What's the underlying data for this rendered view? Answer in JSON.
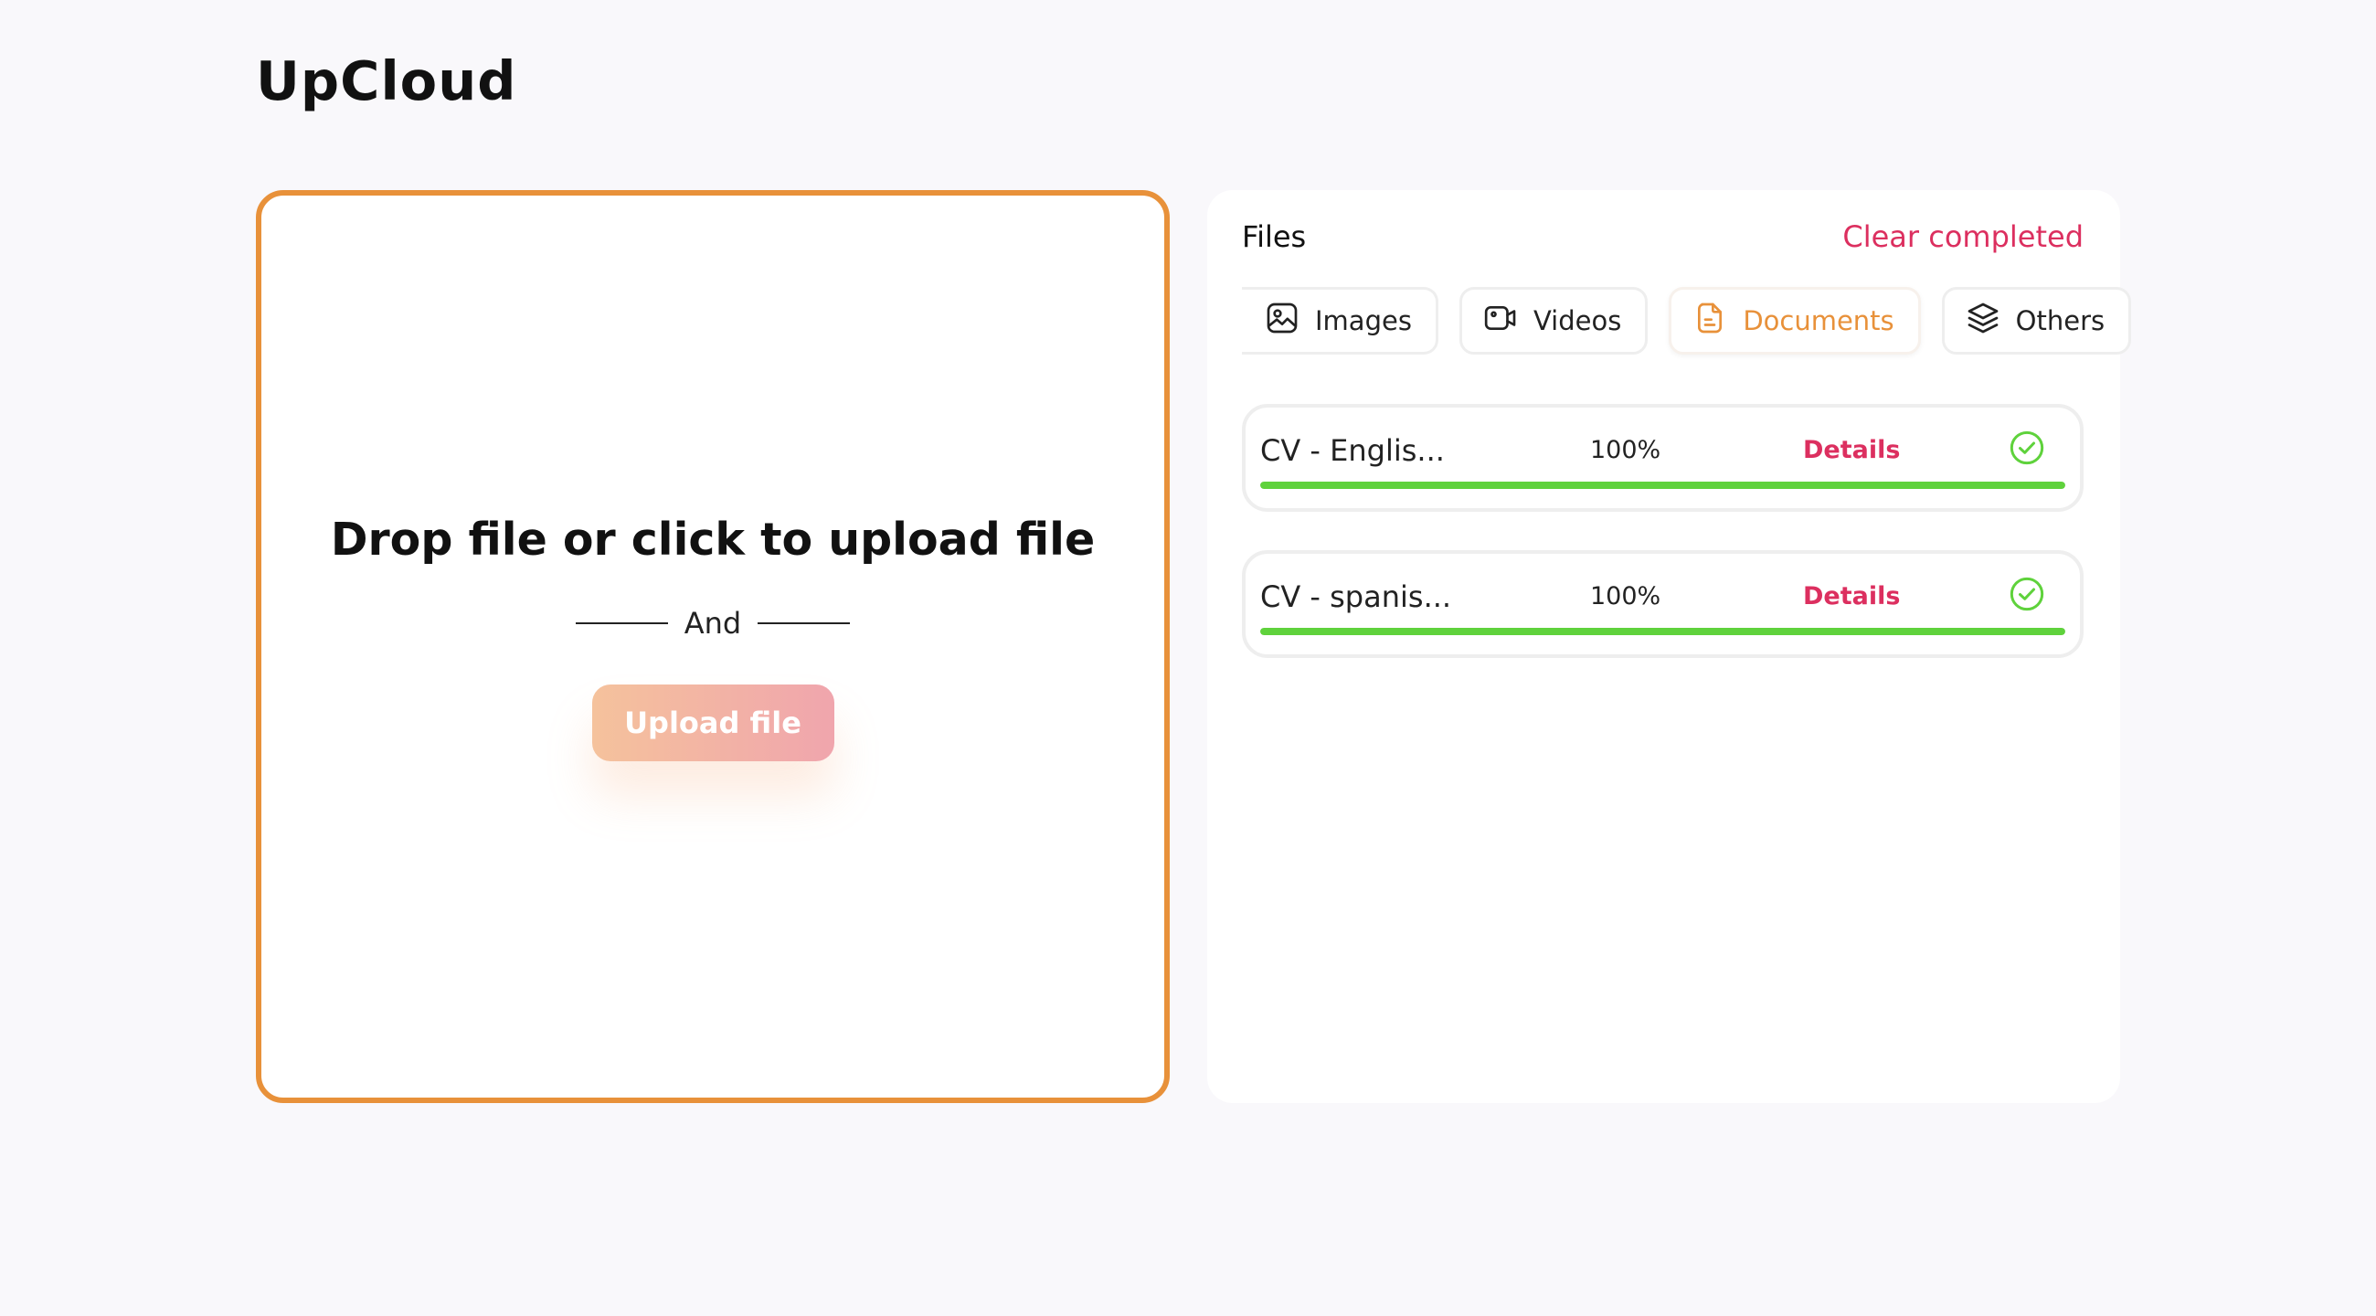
{
  "app": {
    "title": "UpCloud"
  },
  "dropzone": {
    "title": "Drop file or click to upload file",
    "divider_text": "And",
    "upload_label": "Upload file"
  },
  "files": {
    "title": "Files",
    "clear_label": "Clear completed",
    "tabs": [
      {
        "label": "Images",
        "icon": "image-icon",
        "active": false
      },
      {
        "label": "Videos",
        "icon": "video-icon",
        "active": false
      },
      {
        "label": "Documents",
        "icon": "document-icon",
        "active": true
      },
      {
        "label": "Others",
        "icon": "layers-icon",
        "active": false
      }
    ],
    "items": [
      {
        "name": "CV - Englis...",
        "progress_text": "100%",
        "progress": 1.0,
        "details_label": "Details",
        "status": "completed"
      },
      {
        "name": "CV - spanis...",
        "progress_text": "100%",
        "progress": 1.0,
        "details_label": "Details",
        "status": "completed"
      }
    ]
  },
  "colors": {
    "accent": "#e8913a",
    "link": "#dc2f5f",
    "success": "#5fd23c",
    "background": "#f9f8fb"
  }
}
